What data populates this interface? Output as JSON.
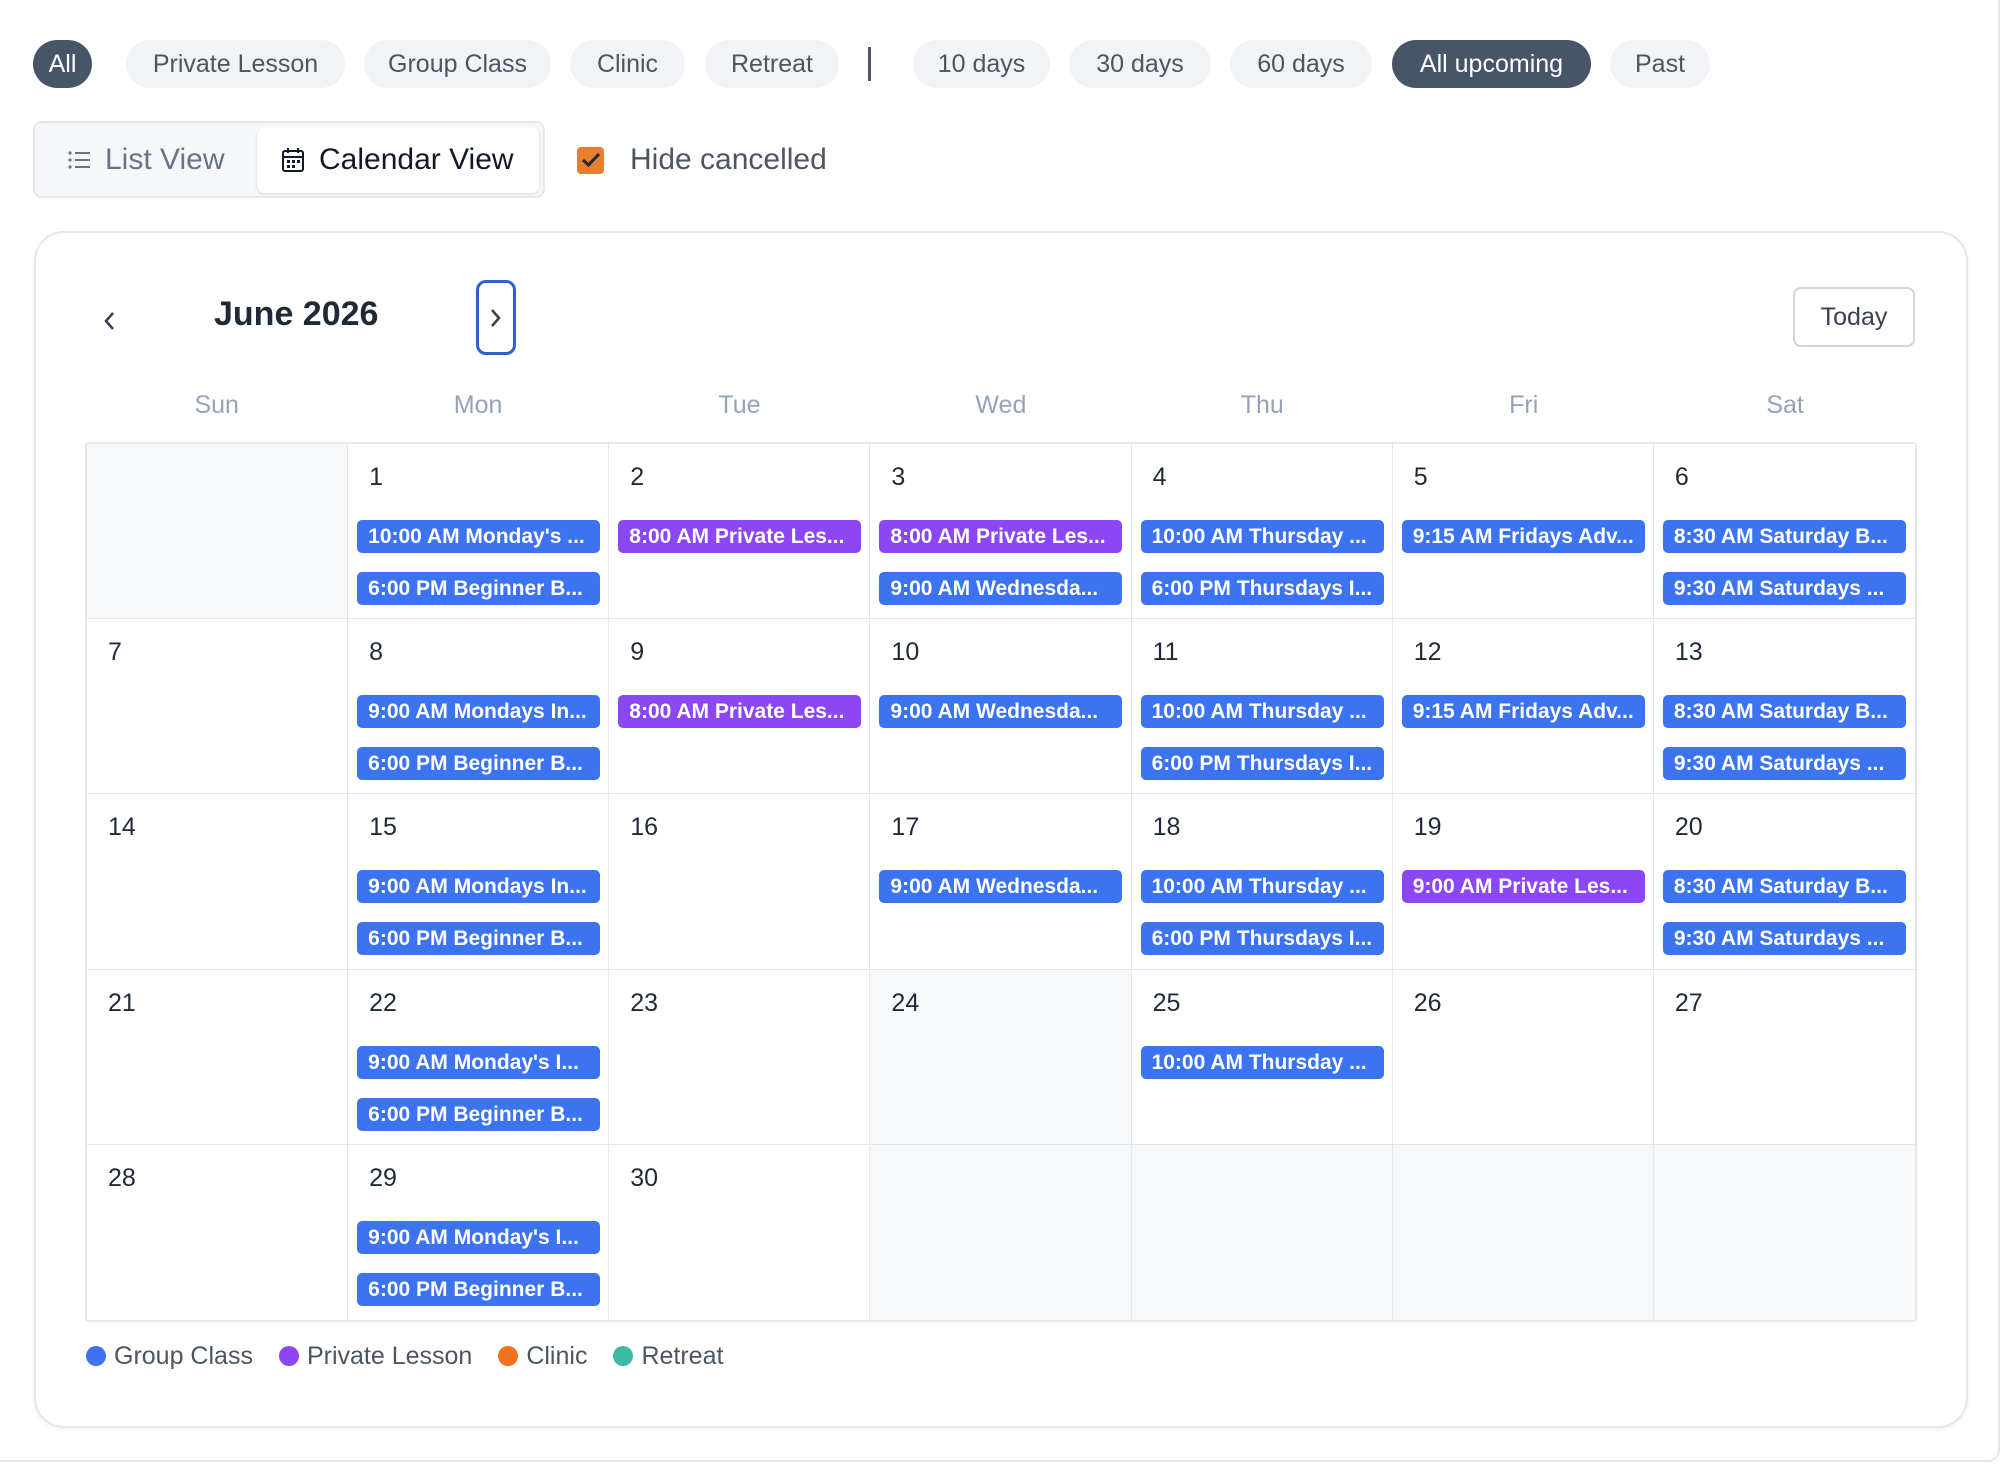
{
  "filters": {
    "types": [
      {
        "label": "All",
        "active": true
      },
      {
        "label": "Private Lesson",
        "active": false
      },
      {
        "label": "Group Class",
        "active": false
      },
      {
        "label": "Clinic",
        "active": false
      },
      {
        "label": "Retreat",
        "active": false
      }
    ],
    "ranges": [
      {
        "label": "10 days",
        "active": false
      },
      {
        "label": "30 days",
        "active": false
      },
      {
        "label": "60 days",
        "active": false
      },
      {
        "label": "All upcoming",
        "active": true
      },
      {
        "label": "Past",
        "active": false
      }
    ]
  },
  "view_toggle": {
    "list_label": "List View",
    "calendar_label": "Calendar View",
    "selected": "calendar"
  },
  "hide_cancelled": {
    "label": "Hide cancelled",
    "checked": true
  },
  "calendar": {
    "month_title": "June 2026",
    "today_label": "Today",
    "weekdays": [
      "Sun",
      "Mon",
      "Tue",
      "Wed",
      "Thu",
      "Fri",
      "Sat"
    ],
    "weeks": [
      [
        {
          "day": "",
          "muted": true,
          "events": []
        },
        {
          "day": "1",
          "events": [
            {
              "text": "10:00 AM Monday's ...",
              "type": "group"
            },
            {
              "text": "6:00 PM Beginner B...",
              "type": "group"
            }
          ]
        },
        {
          "day": "2",
          "events": [
            {
              "text": "8:00 AM Private Les...",
              "type": "private"
            }
          ]
        },
        {
          "day": "3",
          "events": [
            {
              "text": "8:00 AM Private Les...",
              "type": "private"
            },
            {
              "text": "9:00 AM Wednesda...",
              "type": "group"
            }
          ]
        },
        {
          "day": "4",
          "events": [
            {
              "text": "10:00 AM Thursday ...",
              "type": "group"
            },
            {
              "text": "6:00 PM Thursdays I...",
              "type": "group"
            }
          ]
        },
        {
          "day": "5",
          "events": [
            {
              "text": "9:15 AM Fridays Adv...",
              "type": "group"
            }
          ]
        },
        {
          "day": "6",
          "events": [
            {
              "text": "8:30 AM Saturday B...",
              "type": "group"
            },
            {
              "text": "9:30 AM Saturdays ...",
              "type": "group"
            }
          ]
        }
      ],
      [
        {
          "day": "7",
          "events": []
        },
        {
          "day": "8",
          "events": [
            {
              "text": "9:00 AM Mondays In...",
              "type": "group"
            },
            {
              "text": "6:00 PM Beginner B...",
              "type": "group"
            }
          ]
        },
        {
          "day": "9",
          "events": [
            {
              "text": "8:00 AM Private Les...",
              "type": "private"
            }
          ]
        },
        {
          "day": "10",
          "events": [
            {
              "text": "9:00 AM Wednesda...",
              "type": "group"
            }
          ]
        },
        {
          "day": "11",
          "events": [
            {
              "text": "10:00 AM Thursday ...",
              "type": "group"
            },
            {
              "text": "6:00 PM Thursdays I...",
              "type": "group"
            }
          ]
        },
        {
          "day": "12",
          "events": [
            {
              "text": "9:15 AM Fridays Adv...",
              "type": "group"
            }
          ]
        },
        {
          "day": "13",
          "events": [
            {
              "text": "8:30 AM Saturday B...",
              "type": "group"
            },
            {
              "text": "9:30 AM Saturdays ...",
              "type": "group"
            }
          ]
        }
      ],
      [
        {
          "day": "14",
          "events": []
        },
        {
          "day": "15",
          "events": [
            {
              "text": "9:00 AM Mondays In...",
              "type": "group"
            },
            {
              "text": "6:00 PM Beginner B...",
              "type": "group"
            }
          ]
        },
        {
          "day": "16",
          "events": []
        },
        {
          "day": "17",
          "events": [
            {
              "text": "9:00 AM Wednesda...",
              "type": "group"
            }
          ]
        },
        {
          "day": "18",
          "events": [
            {
              "text": "10:00 AM Thursday ...",
              "type": "group"
            },
            {
              "text": "6:00 PM Thursdays I...",
              "type": "group"
            }
          ]
        },
        {
          "day": "19",
          "events": [
            {
              "text": "9:00 AM Private Les...",
              "type": "private"
            }
          ]
        },
        {
          "day": "20",
          "events": [
            {
              "text": "8:30 AM Saturday B...",
              "type": "group"
            },
            {
              "text": "9:30 AM Saturdays ...",
              "type": "group"
            }
          ]
        }
      ],
      [
        {
          "day": "21",
          "events": []
        },
        {
          "day": "22",
          "events": [
            {
              "text": "9:00 AM Monday's I...",
              "type": "group"
            },
            {
              "text": "6:00 PM Beginner B...",
              "type": "group"
            }
          ]
        },
        {
          "day": "23",
          "events": []
        },
        {
          "day": "24",
          "muted": true,
          "events": []
        },
        {
          "day": "25",
          "events": [
            {
              "text": "10:00 AM Thursday ...",
              "type": "group"
            }
          ]
        },
        {
          "day": "26",
          "events": []
        },
        {
          "day": "27",
          "events": []
        }
      ],
      [
        {
          "day": "28",
          "events": []
        },
        {
          "day": "29",
          "events": [
            {
              "text": "9:00 AM Monday's I...",
              "type": "group"
            },
            {
              "text": "6:00 PM Beginner B...",
              "type": "group"
            }
          ]
        },
        {
          "day": "30",
          "events": []
        },
        {
          "day": "",
          "muted": true,
          "events": []
        },
        {
          "day": "",
          "muted": true,
          "events": []
        },
        {
          "day": "",
          "muted": true,
          "events": []
        },
        {
          "day": "",
          "muted": true,
          "events": []
        }
      ]
    ]
  },
  "legend": [
    {
      "label": "Group Class",
      "color": "#3b73f0"
    },
    {
      "label": "Private Lesson",
      "color": "#8b47f3"
    },
    {
      "label": "Clinic",
      "color": "#f2711c"
    },
    {
      "label": "Retreat",
      "color": "#3dbaa4"
    }
  ],
  "colors": {
    "group": "#3b73f0",
    "private": "#8b47f3",
    "clinic": "#f2711c",
    "retreat": "#3dbaa4",
    "chip_active": "#475569",
    "checkbox": "#e87e2f",
    "focus_ring": "#2f5fd0"
  }
}
